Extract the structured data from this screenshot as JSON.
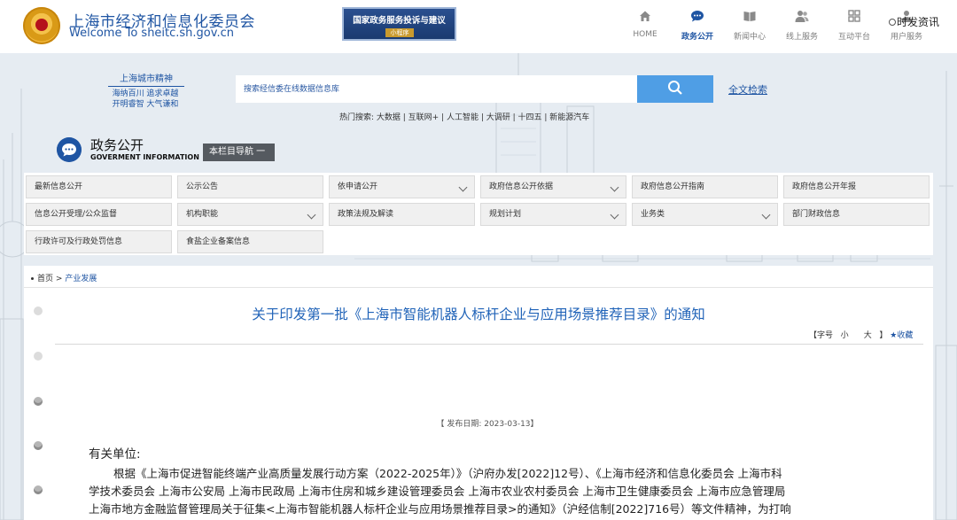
{
  "header": {
    "title_cn": "上海市经济和信息化委员会",
    "title_en": "Welcome  To  sheitc.sh.gov.cn",
    "banner": {
      "title": "国家政务服务投诉与建议",
      "subtitle": "小程序"
    },
    "nav": [
      {
        "label": "HOME",
        "icon": "home-icon",
        "active": false
      },
      {
        "label": "政务公开",
        "icon": "chat-bubble-icon",
        "active": true
      },
      {
        "label": "新闻中心",
        "icon": "book-icon",
        "active": false
      },
      {
        "label": "线上服务",
        "icon": "users-icon",
        "active": false
      },
      {
        "label": "互动平台",
        "icon": "grid-icon",
        "active": false
      },
      {
        "label": "用户服务",
        "icon": "user-icon",
        "active": false
      }
    ],
    "ext_link": "时发资讯"
  },
  "spirit": {
    "title": "上海城市精神",
    "line1": "海纳百川 追求卓越",
    "line2": "开明睿智 大气谦和"
  },
  "search": {
    "placeholder": "搜索经信委在线数据信息库",
    "fulltext_label": "全文检索",
    "hot_label": "热门搜索:",
    "hot_terms": "大数据 | 互联网+ | 人工智能 | 大调研 | 十四五 | 新能源汽车"
  },
  "section": {
    "title_cn": "政务公开",
    "title_en": "GOVERMENT INFORMATION",
    "column_nav": "本栏目导航 一"
  },
  "grid_items": [
    {
      "label": "最新信息公开",
      "dropdown": false
    },
    {
      "label": "公示公告",
      "dropdown": false
    },
    {
      "label": "依申请公开",
      "dropdown": true
    },
    {
      "label": "政府信息公开依据",
      "dropdown": true
    },
    {
      "label": "政府信息公开指南",
      "dropdown": false
    },
    {
      "label": "政府信息公开年报",
      "dropdown": false
    },
    {
      "label": "信息公开受理/公众监督",
      "dropdown": false
    },
    {
      "label": "机构职能",
      "dropdown": true
    },
    {
      "label": "政策法规及解读",
      "dropdown": false
    },
    {
      "label": "规划计划",
      "dropdown": true
    },
    {
      "label": "业务类",
      "dropdown": true
    },
    {
      "label": "部门财政信息",
      "dropdown": false
    },
    {
      "label": "行政许可及行政处罚信息",
      "dropdown": false
    },
    {
      "label": "食盐企业备案信息",
      "dropdown": false
    }
  ],
  "breadcrumb": {
    "home": "首页",
    "separator": ">",
    "current": "产业发展"
  },
  "article": {
    "title": "关于印发第一批《上海市智能机器人标杆企业与应用场景推荐目录》的通知",
    "font_size_label": "【字号",
    "font_small": "小",
    "font_large": "大",
    "font_close": "】",
    "favorite": "★收藏",
    "publish_date": "【 发布日期: 2023-03-13】",
    "salutation": "有关单位:",
    "lines": [
      "根据《上海市促进智能终端产业高质量发展行动方案（2022-2025年）》（沪府办发[2022]12号）、《上海市经济和信息化委员会 上海市科",
      "学技术委员会 上海市公安局 上海市民政局 上海市住房和城乡建设管理委员会 上海市农业农村委员会 上海市卫生健康委员会 上海市应急管理局",
      "上海市地方金融监督管理局关于征集<上海市智能机器人标杆企业与应用场景推荐目录>的通知》（沪经信制[2022]716号）等文件精神，为打响"
    ]
  }
}
